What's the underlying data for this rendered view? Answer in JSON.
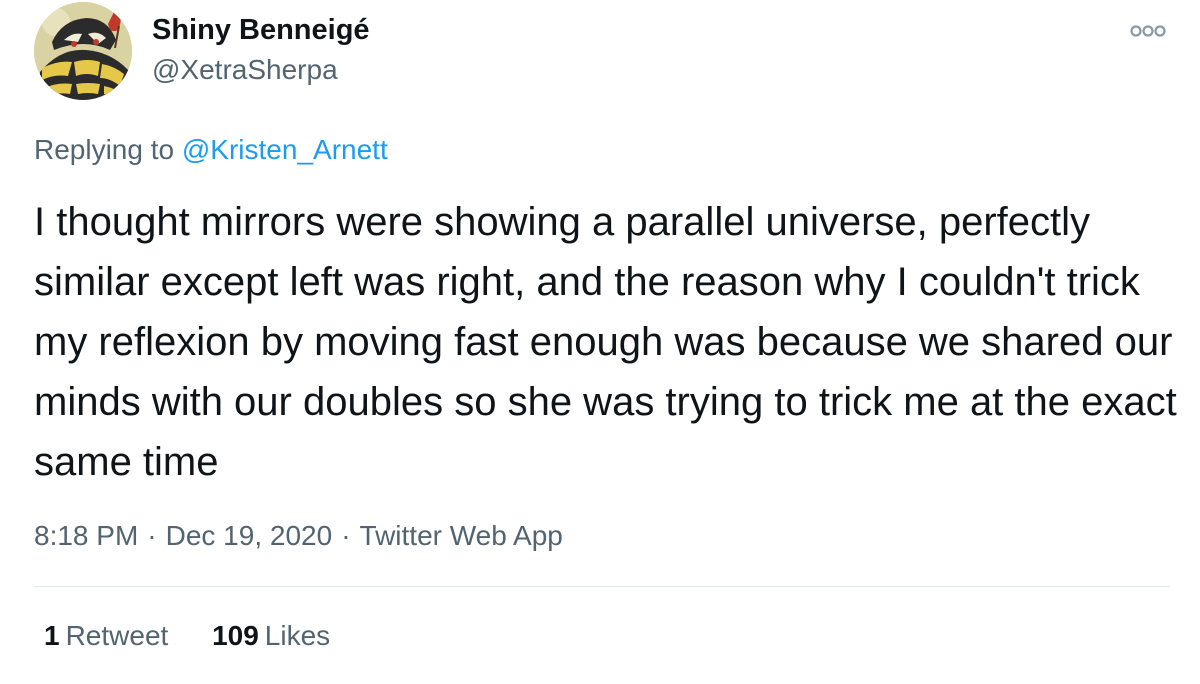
{
  "author": {
    "display_name": "Shiny Benneigé",
    "handle": "@XetraSherpa"
  },
  "icons": {
    "more": "more-options-icon",
    "avatar": "avatar-image"
  },
  "reply": {
    "prefix": "Replying to",
    "mention": "@Kristen_Arnett"
  },
  "tweet": {
    "text": "I thought mirrors were showing a parallel universe, perfectly similar except left was right, and the reason why I couldn't trick my reflexion by moving fast enough was because we shared our minds with our doubles so she was trying to trick me at the exact same time"
  },
  "meta": {
    "time": "8:18 PM",
    "separator": "·",
    "date": "Dec 19, 2020",
    "source": "Twitter Web App"
  },
  "stats": {
    "retweets_count": "1",
    "retweets_label": "Retweet",
    "likes_count": "109",
    "likes_label": "Likes"
  },
  "colors": {
    "link": "#1d9bf0",
    "secondary_text": "#536471",
    "primary_text": "#0f1419",
    "divider": "#e1e8ed"
  }
}
